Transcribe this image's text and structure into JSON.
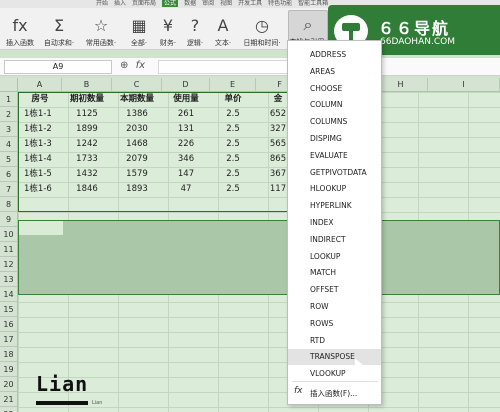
{
  "ribbon": {
    "tabs": [
      "开始",
      "插入",
      "页面布局",
      "公式",
      "数据",
      "审阅",
      "视图",
      "开发工具",
      "特色功能",
      "智能工具箱"
    ],
    "active_tab": "公式",
    "buttons": [
      {
        "label": "插入函数",
        "icon": "fx"
      },
      {
        "label": "自动求和·",
        "icon": "Σ"
      },
      {
        "label": "常用函数·",
        "icon": "☆"
      },
      {
        "label": "全部·",
        "icon": "▦"
      },
      {
        "label": "财务·",
        "icon": "¥"
      },
      {
        "label": "逻辑·",
        "icon": "?"
      },
      {
        "label": "文本·",
        "icon": "A"
      },
      {
        "label": "日期和时间·",
        "icon": "◷"
      },
      {
        "label": "查找与引用·",
        "icon": "⌕"
      }
    ]
  },
  "logo": {
    "title": "６６导航",
    "url": "66DAOHAN.COM",
    "brand_color": "#2f7d36"
  },
  "formula_bar": {
    "name_box": "A9",
    "zoom_icon": "⊕",
    "fx": "fx"
  },
  "sheet": {
    "columns": [
      "A",
      "B",
      "C",
      "D",
      "E",
      "F",
      "G",
      "H",
      "I"
    ],
    "rows": [
      "1",
      "2",
      "3",
      "4",
      "5",
      "6",
      "7",
      "8",
      "9",
      "10",
      "11",
      "12",
      "13",
      "14",
      "15",
      "16",
      "17",
      "18",
      "19",
      "20",
      "21",
      "22"
    ],
    "headers": [
      "房号",
      "期初数量",
      "本期数量",
      "使用量",
      "单价",
      "金"
    ],
    "data": [
      [
        "1栋1-1",
        "1125",
        "1386",
        "261",
        "2.5",
        "652"
      ],
      [
        "1栋1-2",
        "1899",
        "2030",
        "131",
        "2.5",
        "327"
      ],
      [
        "1栋1-3",
        "1242",
        "1468",
        "226",
        "2.5",
        "565"
      ],
      [
        "1栋1-4",
        "1733",
        "2079",
        "346",
        "2.5",
        "865"
      ],
      [
        "1栋1-5",
        "1432",
        "1579",
        "147",
        "2.5",
        "367"
      ],
      [
        "1栋1-6",
        "1846",
        "1893",
        "47",
        "2.5",
        "117"
      ]
    ]
  },
  "menu": {
    "items": [
      "ADDRESS",
      "AREAS",
      "CHOOSE",
      "COLUMN",
      "COLUMNS",
      "DISPIMG",
      "EVALUATE",
      "GETPIVOTDATA",
      "HLOOKUP",
      "HYPERLINK",
      "INDEX",
      "INDIRECT",
      "LOOKUP",
      "MATCH",
      "OFFSET",
      "ROW",
      "ROWS",
      "RTD",
      "TRANSPOSE",
      "VLOOKUP"
    ],
    "hover_item": "TRANSPOSE",
    "insert_label": "插入函数(F)..."
  },
  "watermark": {
    "text": "Lian",
    "sub": "Lian"
  }
}
